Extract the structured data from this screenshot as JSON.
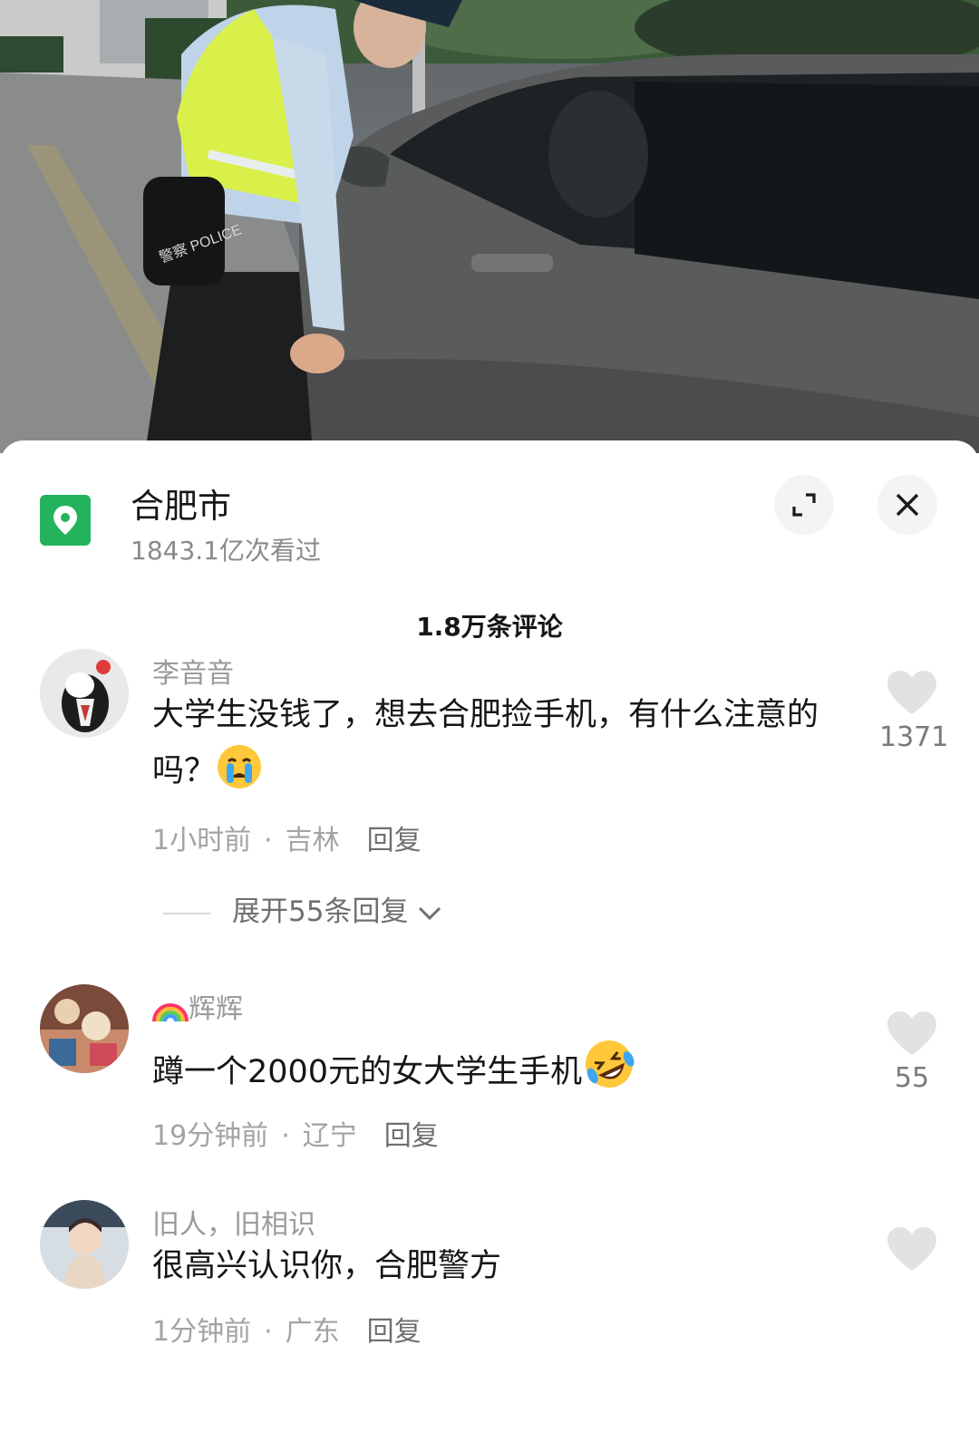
{
  "video": {
    "badge_text": "警察 POLICE"
  },
  "location": {
    "title": "合肥市",
    "views": "1843.1亿次看过"
  },
  "comments_header": {
    "count_label": "1.8万条评论"
  },
  "comments": [
    {
      "username": "李音音",
      "text": "大学生没钱了，想去合肥捡手机，有什么注意的吗？",
      "emoji": "crying-face",
      "time": "1小时前",
      "region": "吉林",
      "reply_label": "回复",
      "likes": "1371",
      "expand_label": "展开55条回复"
    },
    {
      "username": "辉辉",
      "username_prefix_icon": "rainbow",
      "text": "蹲一个2000元的女大学生手机",
      "emoji": "rolling-laughing-face",
      "time": "19分钟前",
      "region": "辽宁",
      "reply_label": "回复",
      "likes": "55"
    },
    {
      "username": "旧人，旧相识",
      "text": "很高兴认识你，合肥警方",
      "time": "1分钟前",
      "region": "广东",
      "reply_label": "回复",
      "likes": ""
    }
  ],
  "colors": {
    "location_icon": "#23b35d",
    "heart": "#e2e2e2",
    "text_primary": "#161616",
    "text_secondary": "#9a9a9a"
  }
}
